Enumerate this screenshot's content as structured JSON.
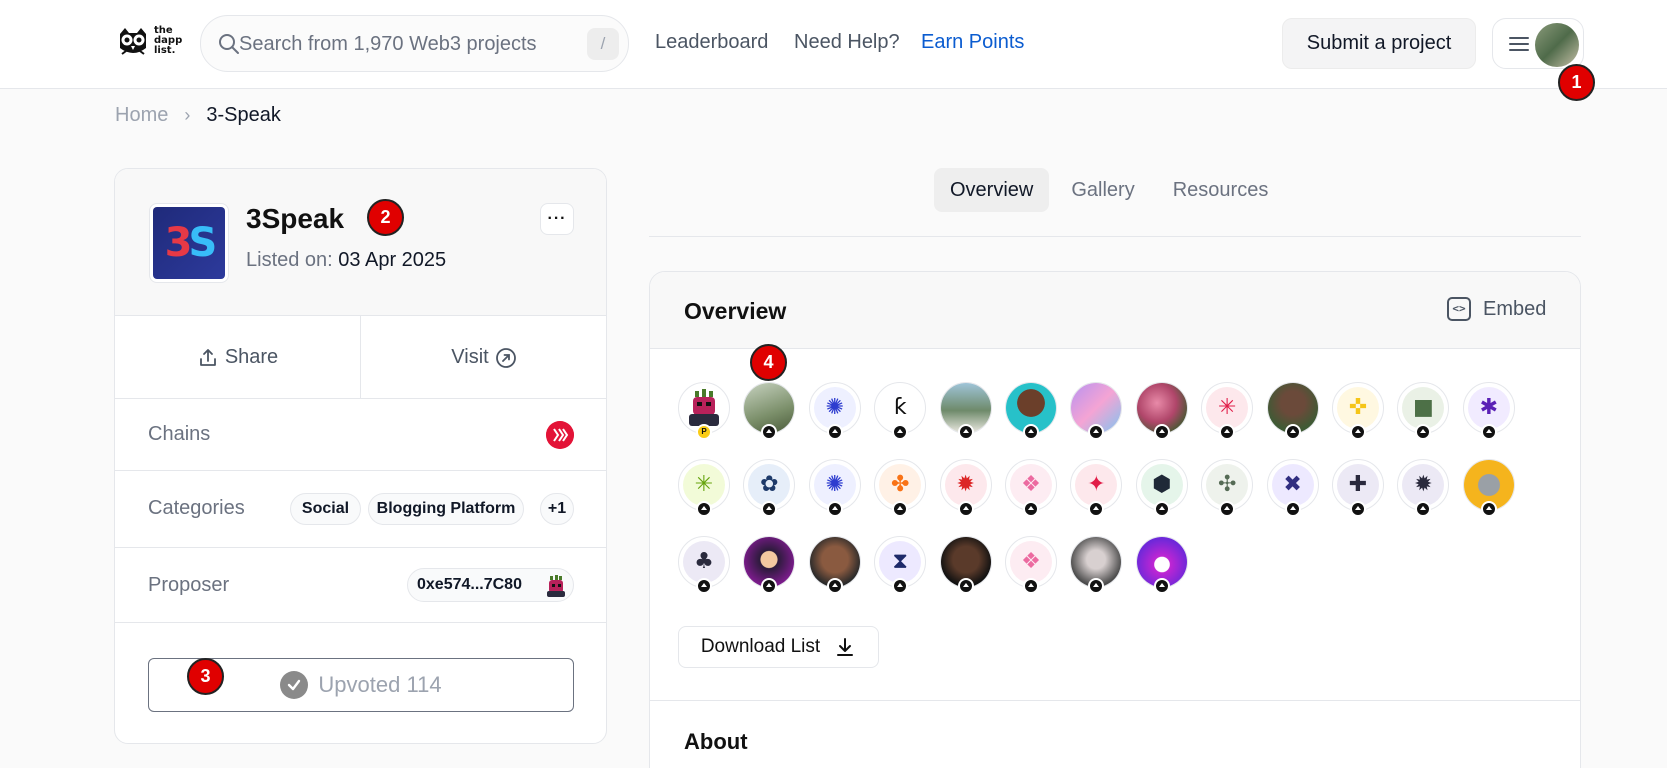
{
  "header": {
    "logo_text": [
      "the",
      "dapp",
      "list."
    ],
    "search": {
      "placeholder": "Search from 1,970 Web3 projects",
      "shortcut": "/"
    },
    "nav": [
      {
        "label": "Leaderboard"
      },
      {
        "label": "Need Help?"
      },
      {
        "label": "Earn Points",
        "color": "#0b5cd0"
      }
    ],
    "submit_label": "Submit a project"
  },
  "markers": [
    "1",
    "2",
    "3",
    "4"
  ],
  "breadcrumb": {
    "home": "Home",
    "separator": "›",
    "current": "3-Speak"
  },
  "project": {
    "logo_text_a": "3",
    "logo_text_b": "S",
    "name": "3Speak",
    "listed_label": "Listed on:",
    "listed_date": "03 Apr 2025",
    "more_label": "···",
    "share_label": "Share",
    "visit_label": "Visit",
    "chains_label": "Chains",
    "chain_icon": "hive-icon",
    "categories_label": "Categories",
    "categories": [
      "Social",
      "Blogging Platform",
      "+1"
    ],
    "proposer_label": "Proposer",
    "proposer_address": "0xe574...7C80",
    "upvote_label": "Upvoted 114"
  },
  "tabs": [
    "Overview",
    "Gallery",
    "Resources"
  ],
  "overview": {
    "title": "Overview",
    "embed_label": "Embed",
    "embed_icon_text": "<>",
    "download_label": "Download List",
    "about_title": "About",
    "upvoter_avatars": [
      {
        "kind": "pixel",
        "bg": "#ffffff",
        "fg": "#b8215a",
        "glyph": "",
        "badge": "P"
      },
      {
        "kind": "photo",
        "bg": "linear-gradient(160deg,#c7d2c0,#7b8f6a 60%,#4a5a3a)"
      },
      {
        "kind": "icon",
        "bg": "#eef0ff",
        "fg": "#2d3ccf",
        "glyph": "✺"
      },
      {
        "kind": "icon",
        "bg": "#ffffff",
        "fg": "#111111",
        "glyph": "ƙ"
      },
      {
        "kind": "photo",
        "bg": "linear-gradient(180deg,#9fc4d8,#6e8a6a 55%,#ece9e2)"
      },
      {
        "kind": "photo",
        "bg": "radial-gradient(circle at 50% 40%,#6b3f2a 35%,#27c1c9 36%)"
      },
      {
        "kind": "photo",
        "bg": "linear-gradient(135deg,#b892f0,#f4a4d4 50%,#7fc4f0)"
      },
      {
        "kind": "photo",
        "bg": "radial-gradient(circle at 40% 40%,#e88aa8,#b0466a 45%,#3f5a2f 80%)"
      },
      {
        "kind": "icon",
        "bg": "#fde8ec",
        "fg": "#e11d48",
        "glyph": "✳"
      },
      {
        "kind": "photo",
        "bg": "radial-gradient(circle at 50% 40%,#6b4a3a 30%,#3f5a35 70%)"
      },
      {
        "kind": "icon",
        "bg": "#fff8e1",
        "fg": "#f5c518",
        "glyph": "✜"
      },
      {
        "kind": "icon",
        "bg": "#eaf1e6",
        "fg": "#4d7047",
        "glyph": "■"
      },
      {
        "kind": "icon",
        "bg": "#f1ebff",
        "fg": "#5b21b6",
        "glyph": "✱"
      },
      {
        "kind": "icon",
        "bg": "#f2fbd8",
        "fg": "#65a30d",
        "glyph": "✳"
      },
      {
        "kind": "icon",
        "bg": "#e6eef9",
        "fg": "#1e3a6a",
        "glyph": "✿"
      },
      {
        "kind": "icon",
        "bg": "#eef0ff",
        "fg": "#2d3ccf",
        "glyph": "✺"
      },
      {
        "kind": "icon",
        "bg": "#fff1e6",
        "fg": "#f97316",
        "glyph": "✤"
      },
      {
        "kind": "icon",
        "bg": "#fde8ec",
        "fg": "#dc2626",
        "glyph": "✹"
      },
      {
        "kind": "icon",
        "bg": "#fdecf2",
        "fg": "#ec6aa0",
        "glyph": "❖"
      },
      {
        "kind": "icon",
        "bg": "#fde8ec",
        "fg": "#e11d48",
        "glyph": "✦"
      },
      {
        "kind": "icon",
        "bg": "#e5f5ea",
        "fg": "#1f2937",
        "glyph": "⬢"
      },
      {
        "kind": "icon",
        "bg": "#eef2ec",
        "fg": "#556b55",
        "glyph": "✣"
      },
      {
        "kind": "icon",
        "bg": "#ede9ff",
        "fg": "#312e81",
        "glyph": "✖"
      },
      {
        "kind": "icon",
        "bg": "#ece9f5",
        "fg": "#2a2a3d",
        "glyph": "✚"
      },
      {
        "kind": "icon",
        "bg": "#ece9f5",
        "fg": "#2a2a3d",
        "glyph": "✹"
      },
      {
        "kind": "photo",
        "bg": "radial-gradient(circle at 50% 50%,#9aa0a6 30%,#f5b41d 32%)"
      },
      {
        "kind": "icon",
        "bg": "#ece9f5",
        "fg": "#2a2a3d",
        "glyph": "♣"
      },
      {
        "kind": "photo",
        "bg": "radial-gradient(circle at 50% 45%,#f3c9a0 22%,#2b1b3a 24%,#7a1b8a 70%)"
      },
      {
        "kind": "photo",
        "bg": "radial-gradient(circle at 50% 45%,#8a5a40 35%,#2a2a2a 70%)"
      },
      {
        "kind": "icon",
        "bg": "#ede9ff",
        "fg": "#1e2a6a",
        "glyph": "⧗"
      },
      {
        "kind": "photo",
        "bg": "radial-gradient(circle at 50% 45%,#5a3a2a 35%,#111 70%)"
      },
      {
        "kind": "icon",
        "bg": "#fdecf2",
        "fg": "#ec6aa0",
        "glyph": "❖"
      },
      {
        "kind": "photo",
        "bg": "radial-gradient(circle at 50% 45%,#d8d0d0 25%,#4b4b4b 70%)"
      },
      {
        "kind": "photo",
        "bg": "radial-gradient(circle at 50% 55%,#fff 20%,#c026d3 22%,#6d28d9 70%)"
      }
    ]
  }
}
